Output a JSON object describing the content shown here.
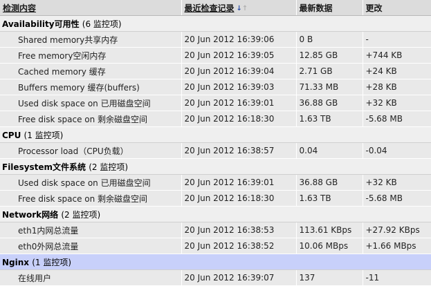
{
  "header": {
    "col_item": "检测内容",
    "col_lastcheck": "最近检查记录",
    "col_lastvalue": "最新数据",
    "col_change": "更改"
  },
  "groups": [
    {
      "name": "Availability可用性",
      "count": "(6 监控项)",
      "items": [
        {
          "name": "Shared memory共享内存",
          "time": "20 Jun 2012 16:39:06",
          "value": "0 B",
          "change": "-"
        },
        {
          "name": "Free memory空闲内存",
          "time": "20 Jun 2012 16:39:05",
          "value": "12.85 GB",
          "change": "+744 KB"
        },
        {
          "name": "Cached memory 缓存",
          "time": "20 Jun 2012 16:39:04",
          "value": "2.71 GB",
          "change": "+24 KB"
        },
        {
          "name": "Buffers memory 缓存(buffers)",
          "time": "20 Jun 2012 16:39:03",
          "value": "71.33 MB",
          "change": "+28 KB"
        },
        {
          "name": "Used disk space on 已用磁盘空间",
          "time": "20 Jun 2012 16:39:01",
          "value": "36.88 GB",
          "change": "+32 KB"
        },
        {
          "name": "Free disk space on 剩余磁盘空间",
          "time": "20 Jun 2012 16:18:30",
          "value": "1.63 TB",
          "change": "-5.68 MB"
        }
      ]
    },
    {
      "name": "CPU",
      "count": "(1 监控项)",
      "items": [
        {
          "name": "Processor load（CPU负载）",
          "time": "20 Jun 2012 16:38:57",
          "value": "0.04",
          "change": "-0.04"
        }
      ]
    },
    {
      "name": "Filesystem文件系统",
      "count": "(2 监控项)",
      "items": [
        {
          "name": "Used disk space on 已用磁盘空间",
          "time": "20 Jun 2012 16:39:01",
          "value": "36.88 GB",
          "change": "+32 KB"
        },
        {
          "name": "Free disk space on 剩余磁盘空间",
          "time": "20 Jun 2012 16:18:30",
          "value": "1.63 TB",
          "change": "-5.68 MB"
        }
      ]
    },
    {
      "name": "Network网络",
      "count": "(2 监控项)",
      "items": [
        {
          "name": "eth1内网总流量",
          "time": "20 Jun 2012 16:38:53",
          "value": "113.61 KBps",
          "change": "+27.92 KBps"
        },
        {
          "name": "eth0外网总流量",
          "time": "20 Jun 2012 16:38:52",
          "value": "10.06 MBps",
          "change": "+1.66 MBps"
        }
      ]
    },
    {
      "name": "Nginx",
      "count": "(1 监控项)",
      "active": true,
      "items": [
        {
          "name": "在线用户",
          "time": "20 Jun 2012 16:39:07",
          "value": "137",
          "change": "-11"
        }
      ]
    }
  ]
}
